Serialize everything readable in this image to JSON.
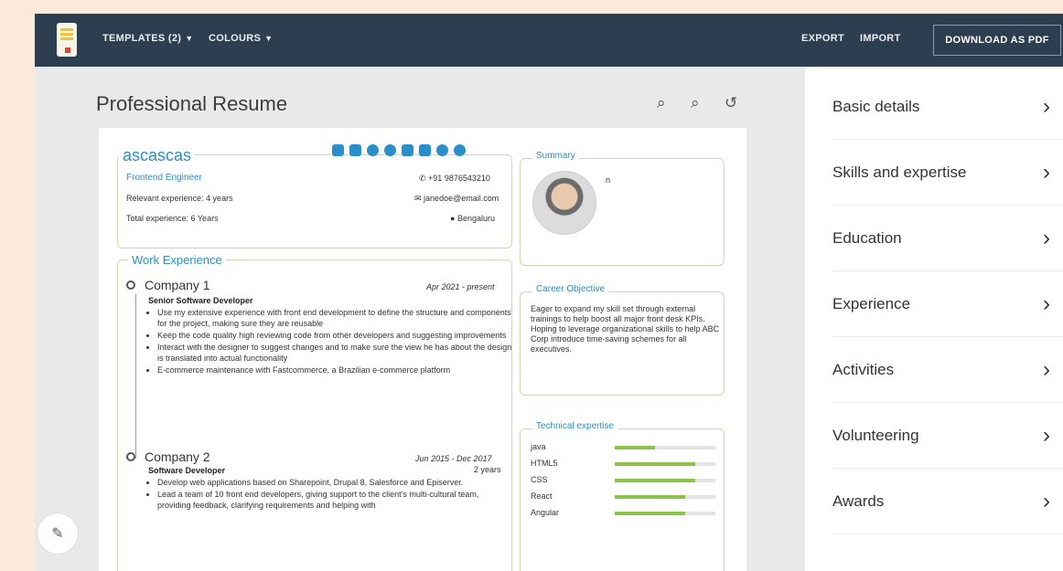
{
  "topbar": {
    "templates_label": "TEMPLATES (2)",
    "colours_label": "COLOURS",
    "export_label": "EXPORT",
    "import_label": "IMPORT",
    "download_label": "DOWNLOAD AS PDF"
  },
  "main": {
    "title": "Professional Resume",
    "tools": [
      "zoom-out-icon",
      "zoom-in-icon",
      "history-icon"
    ]
  },
  "resume": {
    "name": "ascascas",
    "role": "Frontend Engineer",
    "relevant_experience": "Relevant experience: 4 years",
    "total_experience": "Total experience: 6 Years",
    "phone": "+91 9876543210",
    "email": "janedoe@email.com",
    "location": "Bengaluru",
    "summary_label": "Summary",
    "summary_mark": "n",
    "work_label": "Work Experience",
    "jobs": [
      {
        "company": "Company 1",
        "date": "Apr 2021 - present",
        "title": "Senior Software Developer",
        "bullets": [
          "Use my extensive experience with front end development to define the structure and components for the project, making sure they are reusable",
          "Keep the code quality high reviewing code from other developers and suggesting improvements",
          "Interact with the designer to suggest changes and to make sure the view he has about the design is translated into actual functionality",
          "E-commerce maintenance with Fastcommerce, a Brazilian e-commerce platform"
        ]
      },
      {
        "company": "Company 2",
        "date": "Jun 2015 - Dec 2017",
        "duration": "2 years",
        "title": "Software Developer",
        "bullets": [
          "Develop web applications based on Sharepoint, Drupal 8, Salesforce and Episerver.",
          "Lead a team of 10 front end developers, giving support to the client's multi-cultural team, providing feedback, clarifying requirements and helping with"
        ]
      }
    ],
    "objective_label": "Career Objective",
    "objective": "Eager to expand my skill set through external trainings to help boost all major front desk KPIs. Hoping to leverage organizational skills to help ABC Corp introduce time-saving schemes for all executives.",
    "tech_label": "Technical expertise",
    "skills": [
      {
        "name": "java",
        "level": 0.4
      },
      {
        "name": "HTML5",
        "level": 0.8
      },
      {
        "name": "CSS",
        "level": 0.8
      },
      {
        "name": "React",
        "level": 0.7
      },
      {
        "name": "Angular",
        "level": 0.7
      }
    ],
    "accent_color": "#2a8fc9",
    "skill_color": "#8bc34a"
  },
  "sidebar": {
    "items": [
      "Basic details",
      "Skills and expertise",
      "Education",
      "Experience",
      "Activities",
      "Volunteering",
      "Awards"
    ]
  }
}
